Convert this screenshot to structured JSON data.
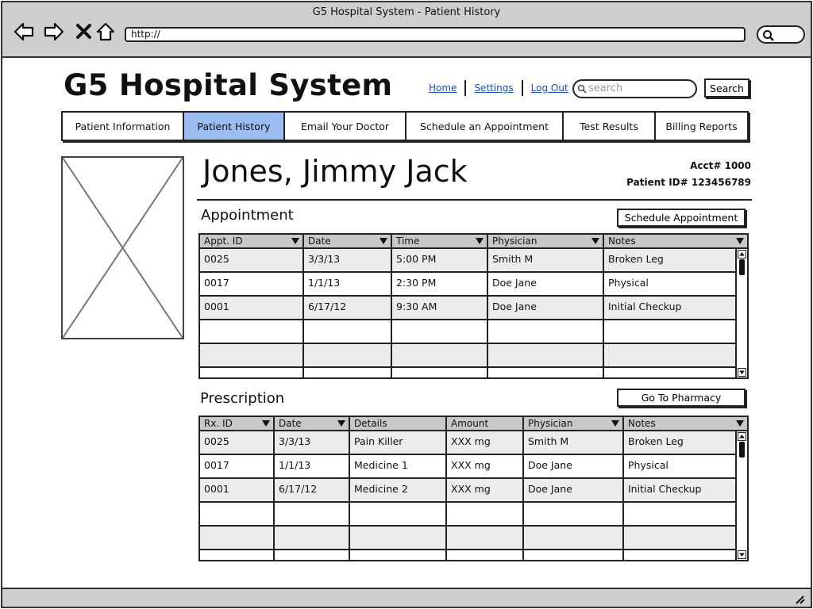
{
  "window": {
    "title": "G5 Hospital System - Patient History",
    "url": "http://"
  },
  "header": {
    "app_title": "G5 Hospital System",
    "links": [
      "Home",
      "Settings",
      "Log Out"
    ],
    "search_placeholder": "search",
    "search_button": "Search"
  },
  "tabs": [
    {
      "label": "Patient Information",
      "active": false
    },
    {
      "label": "Patient History",
      "active": true
    },
    {
      "label": "Email Your Doctor",
      "active": false
    },
    {
      "label": "Schedule an Appointment",
      "active": false
    },
    {
      "label": "Test Results",
      "active": false
    },
    {
      "label": "Billing Reports",
      "active": false
    }
  ],
  "patient": {
    "name": "Jones, Jimmy Jack",
    "acct": "Acct# 1000",
    "patient_id": "Patient ID# 123456789"
  },
  "appointments": {
    "title": "Appointment",
    "action_button": "Schedule Appointment",
    "columns": [
      "Appt. ID",
      "Date",
      "Time",
      "Physician",
      "Notes"
    ],
    "rows": [
      [
        "0025",
        "3/3/13",
        "5:00 PM",
        "Smith M",
        "Broken Leg"
      ],
      [
        "0017",
        "1/1/13",
        "2:30 PM",
        "Doe Jane",
        "Physical"
      ],
      [
        "0001",
        "6/17/12",
        "9:30 AM",
        "Doe Jane",
        "Initial Checkup"
      ]
    ]
  },
  "prescriptions": {
    "title": "Prescription",
    "action_button": "Go To Pharmacy",
    "columns": [
      "Rx. ID",
      "Date",
      "Details",
      "Amount",
      "Physician",
      "Notes"
    ],
    "rows": [
      [
        "0025",
        "3/3/13",
        "Pain Killer",
        "XXX mg",
        "Smith M",
        "Broken Leg"
      ],
      [
        "0017",
        "1/1/13",
        "Medicine 1",
        "XXX mg",
        "Doe Jane",
        "Physical"
      ],
      [
        "0001",
        "6/17/12",
        "Medicine 2",
        "XXX mg",
        "Doe Jane",
        "Initial Checkup"
      ]
    ]
  },
  "colors": {
    "active_tab": "#9cbdf0",
    "chrome": "#cfcfcf",
    "row_shade": "#ececec",
    "link": "#1a4fb3"
  }
}
